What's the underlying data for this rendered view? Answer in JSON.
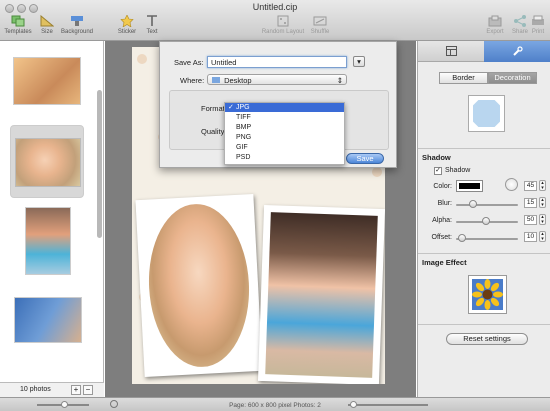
{
  "window": {
    "title": "Untitled.cip"
  },
  "toolbar": {
    "templates": "Templates",
    "size": "Size",
    "background": "Background",
    "sticker": "Sticker",
    "text": "Text",
    "random_layout": "Random Layout",
    "shuffle": "Shuffle",
    "export": "Export",
    "share": "Share",
    "print": "Print"
  },
  "sidebar": {
    "photo_count": "10 photos",
    "add": "+",
    "remove": "−"
  },
  "dialog": {
    "save_as_label": "Save As:",
    "save_as_value": "Untitled",
    "where_label": "Where:",
    "where_value": "Desktop",
    "format_label": "Format",
    "quality_label": "Quality",
    "save_button": "Save",
    "expand_button": "▾",
    "format_options": [
      "JPG",
      "TIFF",
      "BMP",
      "PNG",
      "GIF",
      "PSD"
    ],
    "selected_format": "JPG",
    "checkmark": "✓"
  },
  "panel": {
    "border_tab": "Border",
    "decoration_tab": "Decoration",
    "shadow_title": "Shadow",
    "shadow_checkbox": "Shadow",
    "color_label": "Color:",
    "angle_value": "45",
    "blur_label": "Blur:",
    "blur_value": "15",
    "alpha_label": "Alpha:",
    "alpha_value": "50",
    "offset_label": "Offset:",
    "offset_value": "10",
    "image_effect_title": "Image Effect",
    "reset_button": "Reset settings",
    "blur_fraction": 0.28,
    "alpha_fraction": 0.48,
    "offset_fraction": 0.1
  },
  "status": {
    "page_info": "Page: 600 x 800 pixel  Photos: 2"
  },
  "colors": {
    "accent": "#3a6bd6",
    "canvas_bg": "#7e7e7e",
    "shadow_color": "#000000"
  }
}
